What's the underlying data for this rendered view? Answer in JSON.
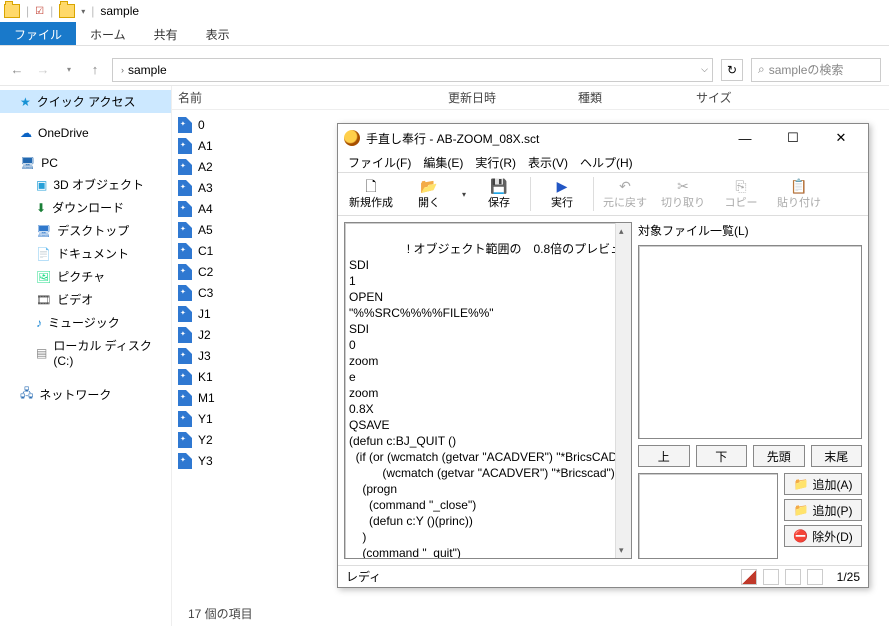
{
  "explorer": {
    "title": "sample",
    "tabs": {
      "file": "ファイル",
      "home": "ホーム",
      "share": "共有",
      "view": "表示"
    },
    "breadcrumb": "sample",
    "search_placeholder": "sampleの検索",
    "columns": {
      "name": "名前",
      "modified": "更新日時",
      "type": "種類",
      "size": "サイズ"
    },
    "nav": {
      "quick": "クイック アクセス",
      "onedrive": "OneDrive",
      "pc": "PC",
      "pc_items": [
        "3D オブジェクト",
        "ダウンロード",
        "デスクトップ",
        "ドキュメント",
        "ピクチャ",
        "ビデオ",
        "ミュージック",
        "ローカル ディスク (C:)"
      ],
      "network": "ネットワーク"
    },
    "files": [
      "0",
      "A1",
      "A2",
      "A3",
      "A4",
      "A5",
      "C1",
      "C2",
      "C3",
      "J1",
      "J2",
      "J3",
      "K1",
      "M1",
      "Y1",
      "Y2",
      "Y3"
    ],
    "status": "17 個の項目"
  },
  "editor": {
    "title": "手直し奉行 - AB-ZOOM_08X.sct",
    "menu": {
      "file": "ファイル(F)",
      "edit": "編集(E)",
      "run": "実行(R)",
      "view": "表示(V)",
      "help": "ヘルプ(H)"
    },
    "toolbar": {
      "new": "新規作成",
      "open": "開く",
      "save": "保存",
      "run": "実行",
      "undo": "元に戻す",
      "cut": "切り取り",
      "copy": "コピー",
      "paste": "貼り付け"
    },
    "script": "! オブジェクト範囲の　0.8倍のプレビューで上書き保存します\nSDI\n1\nOPEN\n\"%%SRC%%%%FILE%%\"\nSDI\n0\nzoom\ne\nzoom\n0.8X\nQSAVE\n(defun c:BJ_QUIT ()\n  (if (or (wcmatch (getvar \"ACADVER\") \"*BricsCAD\")\n          (wcmatch (getvar \"ACADVER\") \"*Bricscad\"))\n    (progn\n      (command \"_close\")\n      (defun c:Y ()(princ))\n    )\n    (command \"_quit\")",
    "right": {
      "list_label": "対象ファイル一覧(L)",
      "up": "上",
      "down": "下",
      "first": "先頭",
      "last": "末尾",
      "add_a": "追加(A)",
      "add_p": "追加(P)",
      "exclude": "除外(D)"
    },
    "status": {
      "ready": "レディ",
      "pos": "1/25"
    }
  }
}
